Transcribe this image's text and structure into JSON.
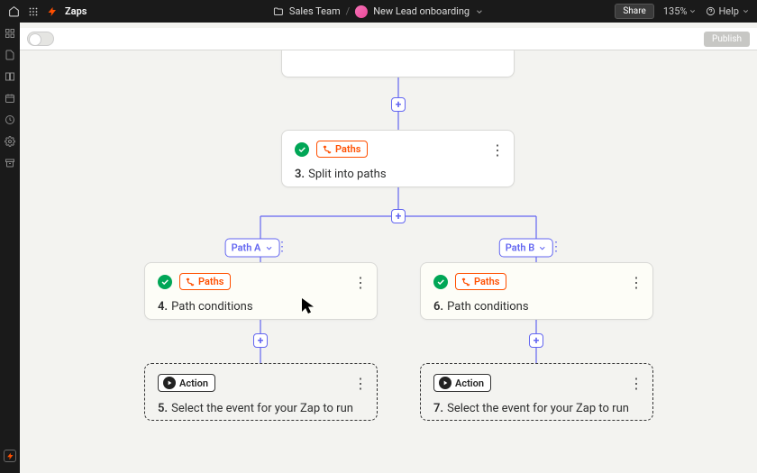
{
  "header": {
    "app": "Zaps",
    "folder": "Sales Team",
    "workflow": "New Lead onboarding",
    "share": "Share",
    "zoom": "135%",
    "help": "Help"
  },
  "toolbar": {
    "publish": "Publish"
  },
  "nodes": {
    "split": {
      "badge": "Paths",
      "num": "3.",
      "text": "Split into paths"
    },
    "pathA": {
      "badge": "Paths",
      "num": "4.",
      "text": "Path conditions"
    },
    "pathB": {
      "badge": "Paths",
      "num": "6.",
      "text": "Path conditions"
    },
    "actionA": {
      "badge": "Action",
      "num": "5.",
      "text": "Select the event for your Zap to run"
    },
    "actionB": {
      "badge": "Action",
      "num": "7.",
      "text": "Select the event for your Zap to run"
    }
  },
  "labels": {
    "a": "Path A",
    "b": "Path B"
  }
}
